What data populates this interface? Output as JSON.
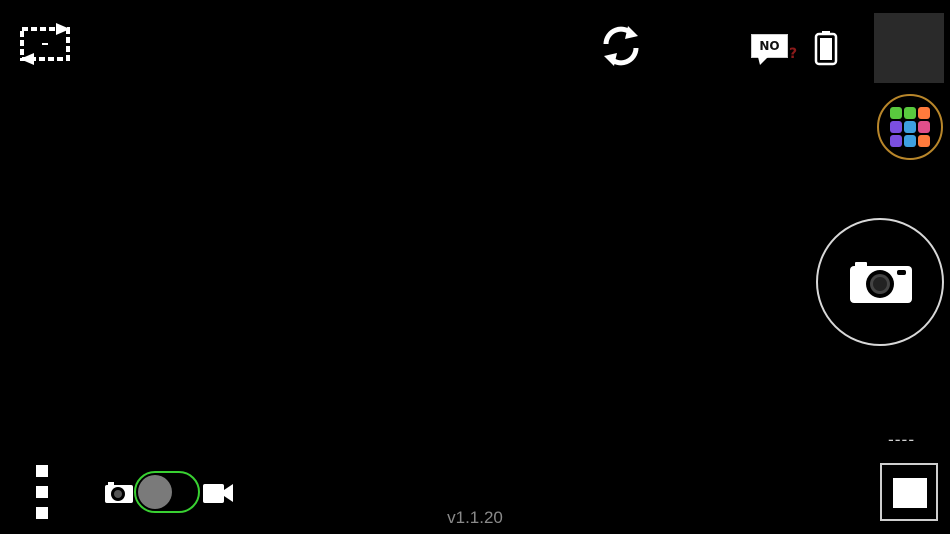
{
  "top_bar": {
    "aspect_icon": "aspect-ratio-toggle-icon",
    "rotate_icon": "switch-camera-icon",
    "no_badge": {
      "text": "NO",
      "question": "?",
      "question_color": "#8b1a1a"
    },
    "battery_icon": "battery-icon"
  },
  "right_panel": {
    "thumbnail_color": "#2a2a2a",
    "filter_colors": [
      "#59c93e",
      "#59c93e",
      "#ff7a3c",
      "#7b4fe0",
      "#3ea0e0",
      "#e04f8a",
      "#7b4fe0",
      "#3ea0e0",
      "#ff7a3c"
    ],
    "filter_ring_color": "#b8862a",
    "shutter_icon": "camera-icon",
    "dashes": "----",
    "record_icon": "stop-icon"
  },
  "bottom_bar": {
    "menu_icon": "three-dots-icon",
    "photo_icon": "photo-camera-icon",
    "video_icon": "video-camera-icon",
    "switch_accent": "#39d132"
  },
  "version": "v1.1.20"
}
